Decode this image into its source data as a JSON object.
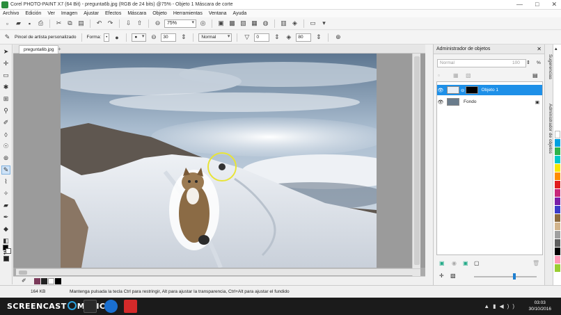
{
  "window": {
    "title": "Corel PHOTO-PAINT X7 (64 Bit) - pregunta6b.jpg (RGB de 24 bits) @75% - Objeto 1 Máscara de corte",
    "controls": [
      "—",
      "□",
      "✕"
    ]
  },
  "menu": [
    "Archivo",
    "Edición",
    "Ver",
    "Imagen",
    "Ajustar",
    "Efectos",
    "Máscara",
    "Objeto",
    "Herramientas",
    "Ventana",
    "Ayuda"
  ],
  "toolbar": {
    "zoom": "75%"
  },
  "propbar": {
    "tool_name": "Pincel de artista personalizado",
    "forma_label": "Forma:",
    "size": "30",
    "mode": "Normal",
    "transparency": "0",
    "feather": "80"
  },
  "document": {
    "tab": "pregunta6b.jpg",
    "tab_plus": "+"
  },
  "docker": {
    "title": "Administrador de objetos",
    "merge_mode": "Normal",
    "opacity": "100",
    "opacity_unit": "%",
    "objects": [
      {
        "name": "Objeto 1",
        "selected": true
      },
      {
        "name": "Fondo",
        "selected": false
      }
    ]
  },
  "side_tabs": [
    "Sugerencias",
    "Administrador de objetos"
  ],
  "palette_colors": [
    "#ffffff",
    "#00a0e0",
    "#2db34a",
    "#00c8c8",
    "#f7e600",
    "#ff8c00",
    "#e01e1e",
    "#c8287a",
    "#7a1fa8",
    "#3c3cc8",
    "#8c6a3c",
    "#d2b48c",
    "#a0a0a0",
    "#606060",
    "#000000",
    "#ff9ab8",
    "#9acd32"
  ],
  "status": {
    "size": "164 KB",
    "hint": "Mantenga pulsada la tecla Ctrl para restringir, Alt para ajustar la transparencia, Ctrl+Alt para ajustar el fundido"
  },
  "taskbar": {
    "brand_left": "SCREENCAST",
    "brand_right": "MATIC",
    "time": "03:03",
    "date": "30/10/2016",
    "app_colors": [
      "#2a2a2a",
      "#1a6fd0",
      "#d42a2a"
    ]
  }
}
